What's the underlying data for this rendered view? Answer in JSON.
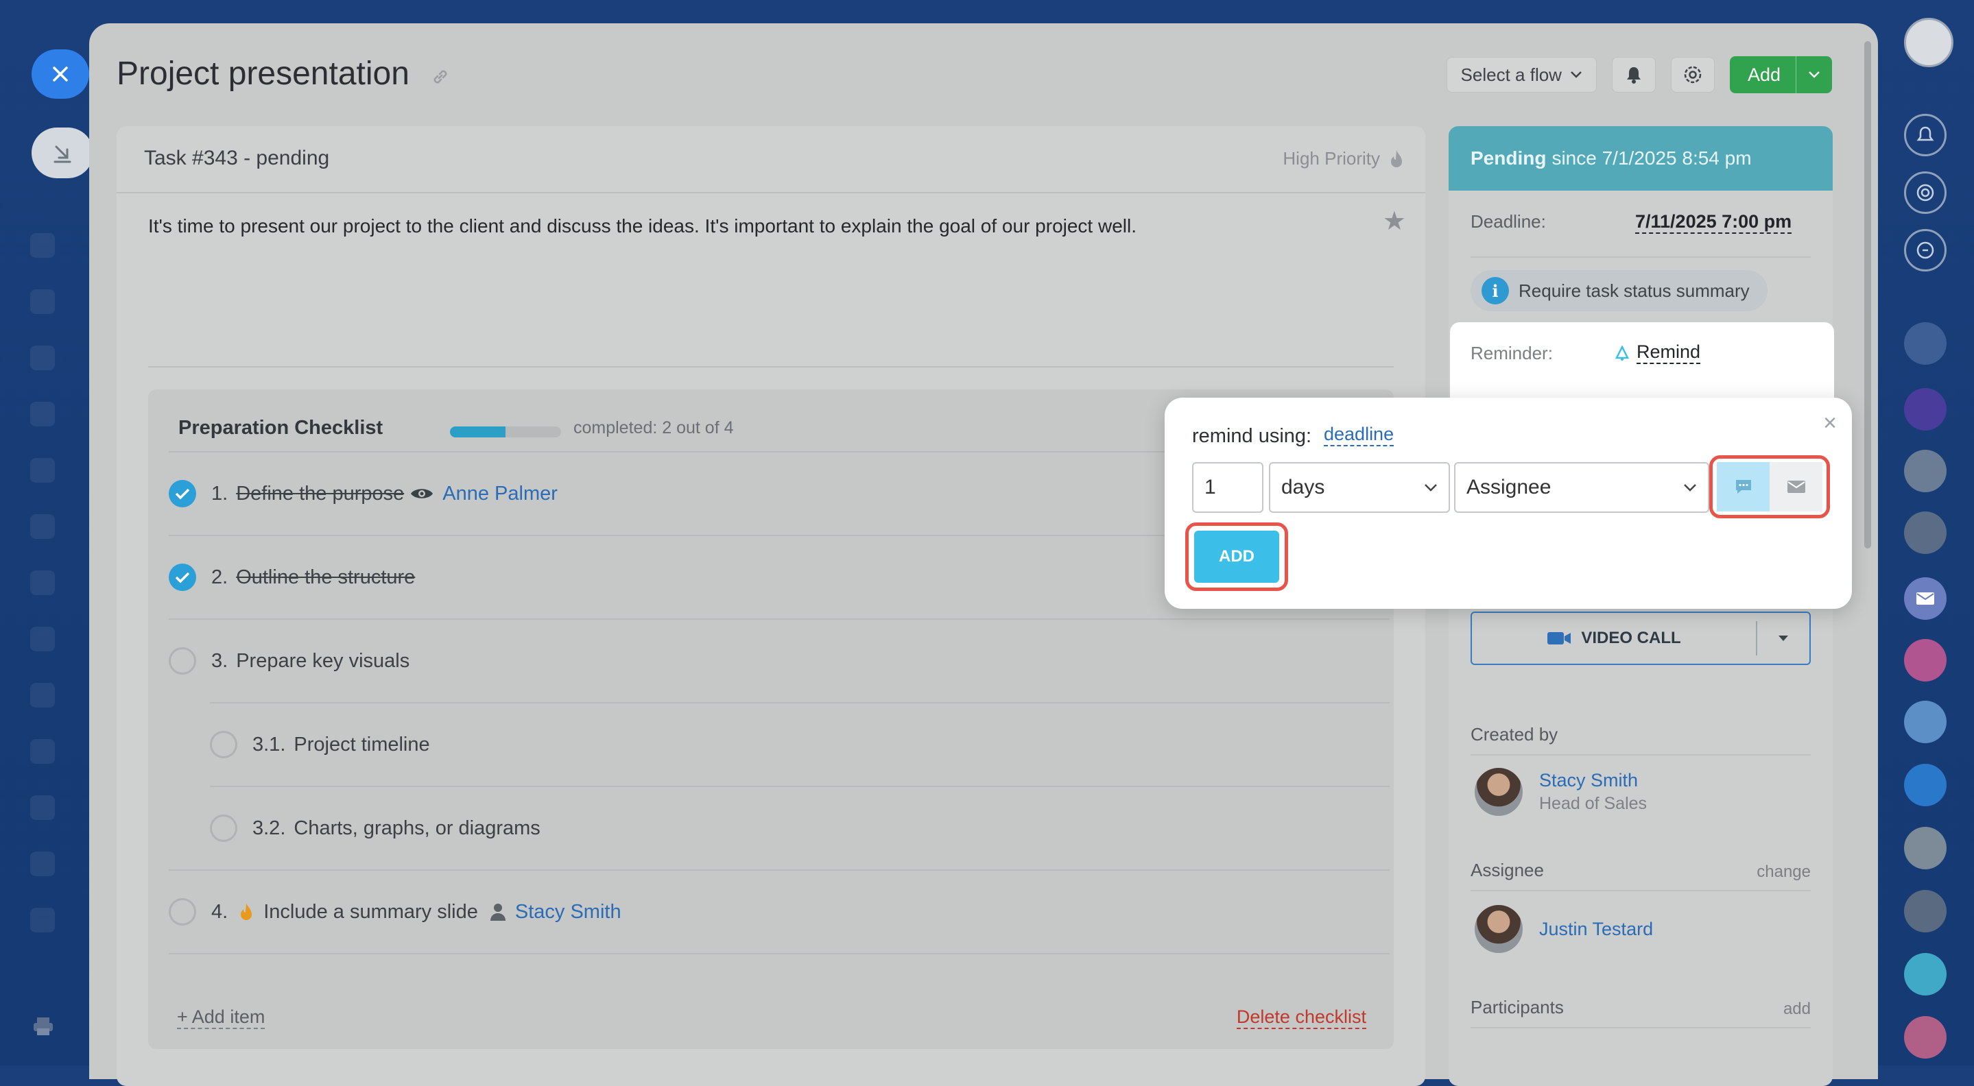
{
  "title": "Project presentation",
  "toolbar": {
    "flow_select": "Select a flow",
    "add_label": "Add"
  },
  "task": {
    "number_status": "Task #343 - pending",
    "priority": "High Priority",
    "description": "It's time to present our project to the client and discuss the ideas. It's important to explain the goal of our project well."
  },
  "checklist": {
    "title": "Preparation Checklist",
    "progress": 0.5,
    "status": "completed: 2 out of 4",
    "items": [
      {
        "num": "1.",
        "text": "Define the purpose",
        "done": true,
        "person": "Anne Palmer"
      },
      {
        "num": "2.",
        "text": "Outline the structure",
        "done": true
      },
      {
        "num": "3.",
        "text": "Prepare key visuals",
        "done": false
      },
      {
        "num": "3.1.",
        "text": "Project timeline",
        "done": false
      },
      {
        "num": "3.2.",
        "text": "Charts, graphs, or diagrams",
        "done": false
      },
      {
        "num": "4.",
        "text": "Include a summary slide",
        "done": false,
        "person": "Stacy Smith"
      }
    ],
    "add_item": "+ Add item",
    "delete": "Delete checklist"
  },
  "sidebar": {
    "status_bold": "Pending",
    "status_rest": "since 7/1/2025 8:54 pm",
    "deadline_label": "Deadline:",
    "deadline_value": "7/11/2025 7:00 pm",
    "summary": "Require task status summary",
    "reminder_label": "Reminder:",
    "reminder_value": "Remind",
    "video_call": "VIDEO CALL",
    "created_by_label": "Created by",
    "creator_name": "Stacy Smith",
    "creator_role": "Head of Sales",
    "assignee_label": "Assignee",
    "assignee_action": "change",
    "assignee_name": "Justin Testard",
    "participants_label": "Participants",
    "participants_action": "add"
  },
  "popup": {
    "remind_using_label": "remind using:",
    "remind_using_value": "deadline",
    "amount": "1",
    "unit": "days",
    "recipient": "Assignee",
    "add_button": "ADD"
  },
  "colors": {
    "accent": "#3bbfe9",
    "highlight": "#e8534a",
    "add_green": "#31a34e",
    "status_teal": "#54a9b8"
  }
}
